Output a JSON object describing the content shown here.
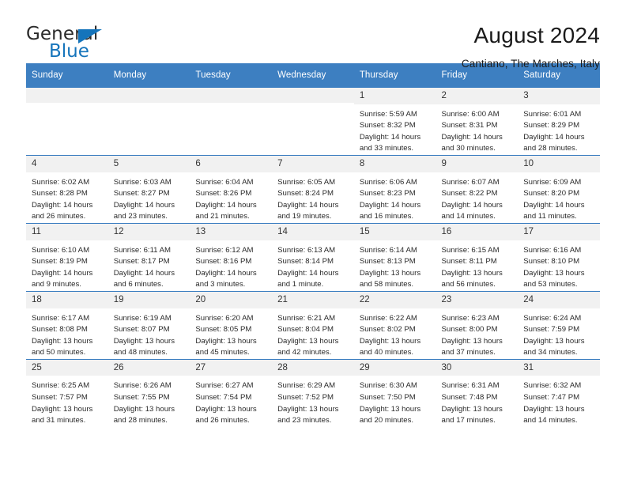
{
  "brand": {
    "name_top": "General",
    "name_bottom": "Blue",
    "triangle_color": "#1574bb",
    "text_color": "#2b2b2b"
  },
  "header": {
    "title": "August 2024",
    "subtitle": "Cantiano, The Marches, Italy"
  },
  "theme": {
    "header_row_bg": "#3d7fc1",
    "header_row_text": "#ffffff",
    "daynum_bg": "#f1f1f1",
    "cell_bg": "#ffffff",
    "grid_line": "#3d7fc1"
  },
  "weekday_headers": [
    "Sunday",
    "Monday",
    "Tuesday",
    "Wednesday",
    "Thursday",
    "Friday",
    "Saturday"
  ],
  "weeks": [
    [
      {
        "day": "",
        "blank": true,
        "sunrise": "",
        "sunset": "",
        "daylight_a": "",
        "daylight_b": ""
      },
      {
        "day": "",
        "blank": true,
        "sunrise": "",
        "sunset": "",
        "daylight_a": "",
        "daylight_b": ""
      },
      {
        "day": "",
        "blank": true,
        "sunrise": "",
        "sunset": "",
        "daylight_a": "",
        "daylight_b": ""
      },
      {
        "day": "",
        "blank": true,
        "sunrise": "",
        "sunset": "",
        "daylight_a": "",
        "daylight_b": ""
      },
      {
        "day": "1",
        "sunrise": "Sunrise: 5:59 AM",
        "sunset": "Sunset: 8:32 PM",
        "daylight_a": "Daylight: 14 hours",
        "daylight_b": "and 33 minutes."
      },
      {
        "day": "2",
        "sunrise": "Sunrise: 6:00 AM",
        "sunset": "Sunset: 8:31 PM",
        "daylight_a": "Daylight: 14 hours",
        "daylight_b": "and 30 minutes."
      },
      {
        "day": "3",
        "sunrise": "Sunrise: 6:01 AM",
        "sunset": "Sunset: 8:29 PM",
        "daylight_a": "Daylight: 14 hours",
        "daylight_b": "and 28 minutes."
      }
    ],
    [
      {
        "day": "4",
        "sunrise": "Sunrise: 6:02 AM",
        "sunset": "Sunset: 8:28 PM",
        "daylight_a": "Daylight: 14 hours",
        "daylight_b": "and 26 minutes."
      },
      {
        "day": "5",
        "sunrise": "Sunrise: 6:03 AM",
        "sunset": "Sunset: 8:27 PM",
        "daylight_a": "Daylight: 14 hours",
        "daylight_b": "and 23 minutes."
      },
      {
        "day": "6",
        "sunrise": "Sunrise: 6:04 AM",
        "sunset": "Sunset: 8:26 PM",
        "daylight_a": "Daylight: 14 hours",
        "daylight_b": "and 21 minutes."
      },
      {
        "day": "7",
        "sunrise": "Sunrise: 6:05 AM",
        "sunset": "Sunset: 8:24 PM",
        "daylight_a": "Daylight: 14 hours",
        "daylight_b": "and 19 minutes."
      },
      {
        "day": "8",
        "sunrise": "Sunrise: 6:06 AM",
        "sunset": "Sunset: 8:23 PM",
        "daylight_a": "Daylight: 14 hours",
        "daylight_b": "and 16 minutes."
      },
      {
        "day": "9",
        "sunrise": "Sunrise: 6:07 AM",
        "sunset": "Sunset: 8:22 PM",
        "daylight_a": "Daylight: 14 hours",
        "daylight_b": "and 14 minutes."
      },
      {
        "day": "10",
        "sunrise": "Sunrise: 6:09 AM",
        "sunset": "Sunset: 8:20 PM",
        "daylight_a": "Daylight: 14 hours",
        "daylight_b": "and 11 minutes."
      }
    ],
    [
      {
        "day": "11",
        "sunrise": "Sunrise: 6:10 AM",
        "sunset": "Sunset: 8:19 PM",
        "daylight_a": "Daylight: 14 hours",
        "daylight_b": "and 9 minutes."
      },
      {
        "day": "12",
        "sunrise": "Sunrise: 6:11 AM",
        "sunset": "Sunset: 8:17 PM",
        "daylight_a": "Daylight: 14 hours",
        "daylight_b": "and 6 minutes."
      },
      {
        "day": "13",
        "sunrise": "Sunrise: 6:12 AM",
        "sunset": "Sunset: 8:16 PM",
        "daylight_a": "Daylight: 14 hours",
        "daylight_b": "and 3 minutes."
      },
      {
        "day": "14",
        "sunrise": "Sunrise: 6:13 AM",
        "sunset": "Sunset: 8:14 PM",
        "daylight_a": "Daylight: 14 hours",
        "daylight_b": "and 1 minute."
      },
      {
        "day": "15",
        "sunrise": "Sunrise: 6:14 AM",
        "sunset": "Sunset: 8:13 PM",
        "daylight_a": "Daylight: 13 hours",
        "daylight_b": "and 58 minutes."
      },
      {
        "day": "16",
        "sunrise": "Sunrise: 6:15 AM",
        "sunset": "Sunset: 8:11 PM",
        "daylight_a": "Daylight: 13 hours",
        "daylight_b": "and 56 minutes."
      },
      {
        "day": "17",
        "sunrise": "Sunrise: 6:16 AM",
        "sunset": "Sunset: 8:10 PM",
        "daylight_a": "Daylight: 13 hours",
        "daylight_b": "and 53 minutes."
      }
    ],
    [
      {
        "day": "18",
        "sunrise": "Sunrise: 6:17 AM",
        "sunset": "Sunset: 8:08 PM",
        "daylight_a": "Daylight: 13 hours",
        "daylight_b": "and 50 minutes."
      },
      {
        "day": "19",
        "sunrise": "Sunrise: 6:19 AM",
        "sunset": "Sunset: 8:07 PM",
        "daylight_a": "Daylight: 13 hours",
        "daylight_b": "and 48 minutes."
      },
      {
        "day": "20",
        "sunrise": "Sunrise: 6:20 AM",
        "sunset": "Sunset: 8:05 PM",
        "daylight_a": "Daylight: 13 hours",
        "daylight_b": "and 45 minutes."
      },
      {
        "day": "21",
        "sunrise": "Sunrise: 6:21 AM",
        "sunset": "Sunset: 8:04 PM",
        "daylight_a": "Daylight: 13 hours",
        "daylight_b": "and 42 minutes."
      },
      {
        "day": "22",
        "sunrise": "Sunrise: 6:22 AM",
        "sunset": "Sunset: 8:02 PM",
        "daylight_a": "Daylight: 13 hours",
        "daylight_b": "and 40 minutes."
      },
      {
        "day": "23",
        "sunrise": "Sunrise: 6:23 AM",
        "sunset": "Sunset: 8:00 PM",
        "daylight_a": "Daylight: 13 hours",
        "daylight_b": "and 37 minutes."
      },
      {
        "day": "24",
        "sunrise": "Sunrise: 6:24 AM",
        "sunset": "Sunset: 7:59 PM",
        "daylight_a": "Daylight: 13 hours",
        "daylight_b": "and 34 minutes."
      }
    ],
    [
      {
        "day": "25",
        "sunrise": "Sunrise: 6:25 AM",
        "sunset": "Sunset: 7:57 PM",
        "daylight_a": "Daylight: 13 hours",
        "daylight_b": "and 31 minutes."
      },
      {
        "day": "26",
        "sunrise": "Sunrise: 6:26 AM",
        "sunset": "Sunset: 7:55 PM",
        "daylight_a": "Daylight: 13 hours",
        "daylight_b": "and 28 minutes."
      },
      {
        "day": "27",
        "sunrise": "Sunrise: 6:27 AM",
        "sunset": "Sunset: 7:54 PM",
        "daylight_a": "Daylight: 13 hours",
        "daylight_b": "and 26 minutes."
      },
      {
        "day": "28",
        "sunrise": "Sunrise: 6:29 AM",
        "sunset": "Sunset: 7:52 PM",
        "daylight_a": "Daylight: 13 hours",
        "daylight_b": "and 23 minutes."
      },
      {
        "day": "29",
        "sunrise": "Sunrise: 6:30 AM",
        "sunset": "Sunset: 7:50 PM",
        "daylight_a": "Daylight: 13 hours",
        "daylight_b": "and 20 minutes."
      },
      {
        "day": "30",
        "sunrise": "Sunrise: 6:31 AM",
        "sunset": "Sunset: 7:48 PM",
        "daylight_a": "Daylight: 13 hours",
        "daylight_b": "and 17 minutes."
      },
      {
        "day": "31",
        "sunrise": "Sunrise: 6:32 AM",
        "sunset": "Sunset: 7:47 PM",
        "daylight_a": "Daylight: 13 hours",
        "daylight_b": "and 14 minutes."
      }
    ]
  ]
}
